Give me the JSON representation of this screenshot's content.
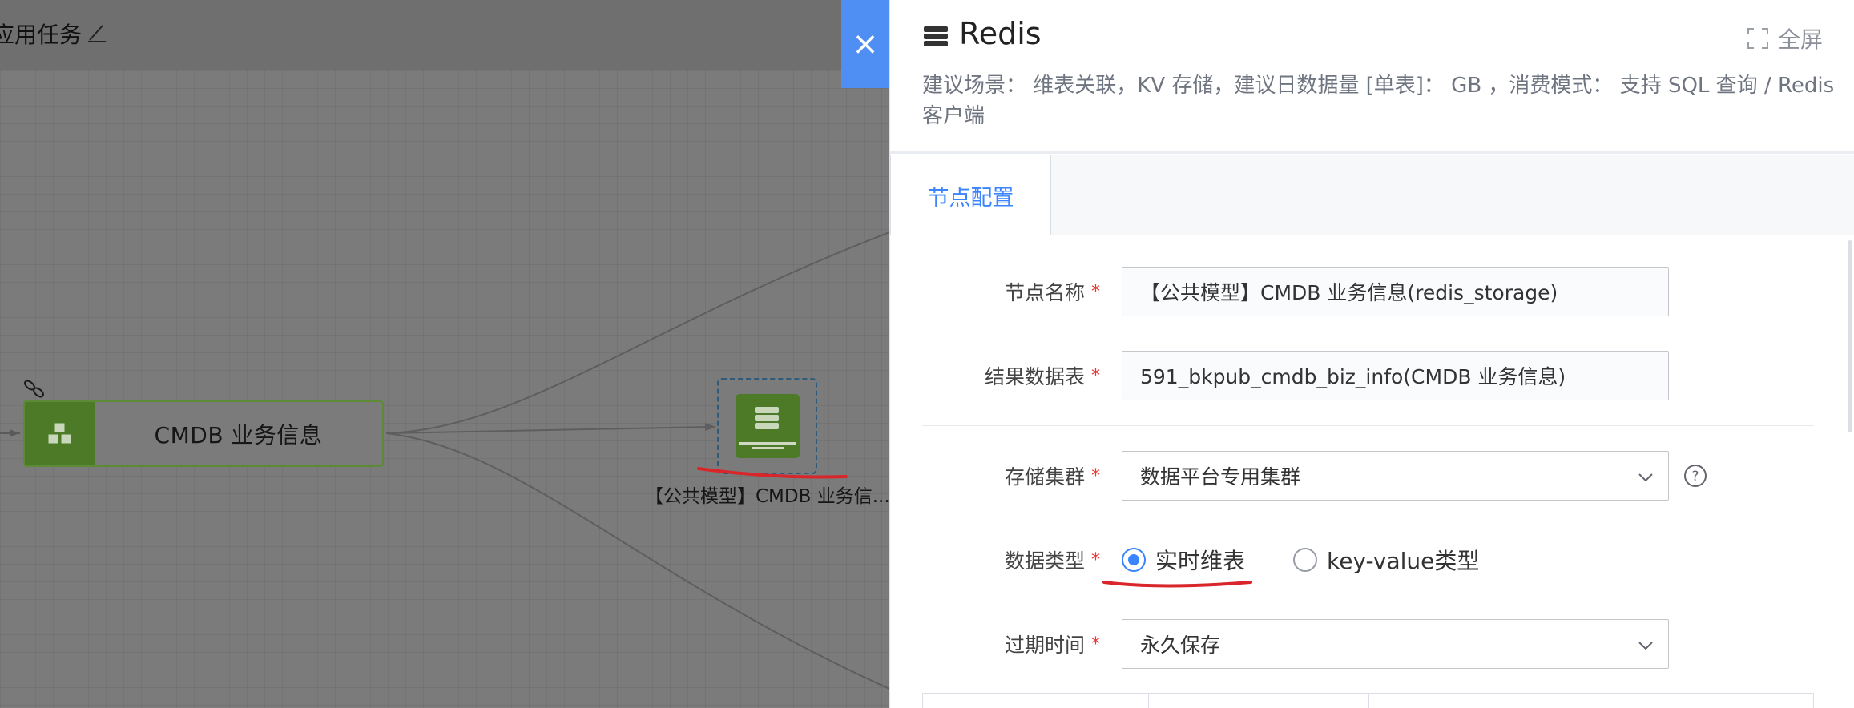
{
  "canvas": {
    "title": "应用任务",
    "nodes": {
      "biz": {
        "label": "CMDB 业务信息"
      },
      "redis": {
        "label": "【公共模型】CMDB 业务信..."
      }
    }
  },
  "drawer": {
    "close_label": "×",
    "title": "Redis",
    "fullscreen_label": "全屏",
    "description": "建议场景： 维表关联，KV 存储，建议日数据量 [单表]： GB ，消费模式： 支持 SQL 查询 / Redis 客户端",
    "tabs": [
      {
        "label": "节点配置",
        "active": true
      }
    ],
    "form": {
      "node_name": {
        "label": "节点名称",
        "value": "【公共模型】CMDB 业务信息(redis_storage)"
      },
      "result_table": {
        "label": "结果数据表",
        "value": "591_bkpub_cmdb_biz_info(CMDB 业务信息)"
      },
      "cluster": {
        "label": "存储集群",
        "value": "数据平台专用集群"
      },
      "data_type": {
        "label": "数据类型",
        "options": [
          {
            "label": "实时维表",
            "selected": true
          },
          {
            "label": "key-value类型",
            "selected": false
          }
        ]
      },
      "expire": {
        "label": "过期时间",
        "value": "永久保存"
      }
    }
  },
  "colors": {
    "accent": "#3a84ff",
    "close_tab": "#4f8ef2",
    "node_green": "#4c7a26",
    "required": "#ea3636",
    "annotation_red": "#d9262b"
  },
  "icons": [
    "edit-icon",
    "link-icon",
    "database-icon",
    "fullscreen-icon",
    "chevron-down-icon",
    "help-icon"
  ]
}
